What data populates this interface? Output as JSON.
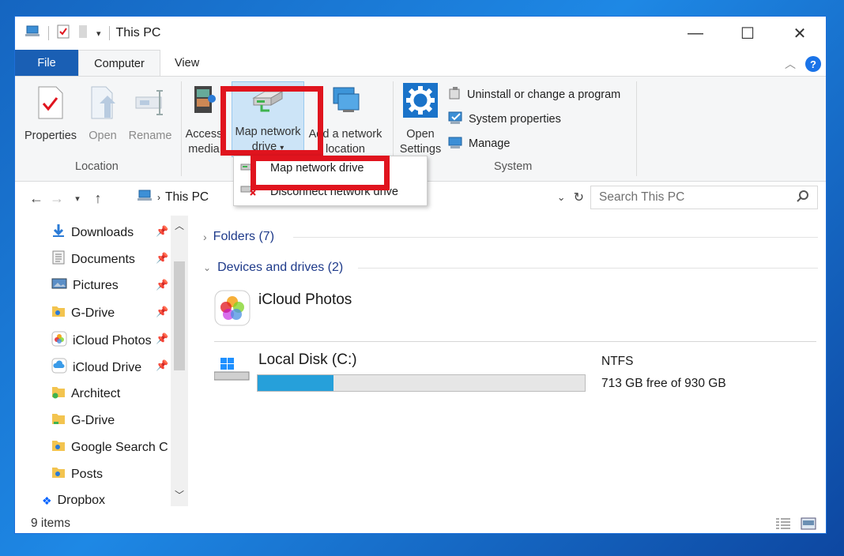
{
  "window": {
    "title": "This PC"
  },
  "tabs": [
    {
      "label": "File"
    },
    {
      "label": "Computer"
    },
    {
      "label": "View"
    }
  ],
  "ribbon": {
    "location_group": {
      "label": "Location",
      "properties": "Properties",
      "open": "Open",
      "rename": "Rename"
    },
    "network_group": {
      "access_media_1": "Access",
      "access_media_2": "media",
      "map_drive_1": "Map network",
      "map_drive_2": "drive",
      "add_location_1": "Add a network",
      "add_location_2": "location"
    },
    "system_group": {
      "label": "System",
      "open_settings_1": "Open",
      "open_settings_2": "Settings",
      "uninstall": "Uninstall or change a program",
      "system_properties": "System properties",
      "manage": "Manage"
    }
  },
  "dropdown": {
    "items": [
      {
        "label": "Map network drive"
      },
      {
        "label": "Disconnect network drive"
      }
    ]
  },
  "address": {
    "path": "This PC",
    "search_placeholder": "Search This PC"
  },
  "sidebar": {
    "items": [
      {
        "label": "Downloads",
        "icon": "download-arrow-icon",
        "pinned": true
      },
      {
        "label": "Documents",
        "icon": "document-icon",
        "pinned": true
      },
      {
        "label": "Pictures",
        "icon": "pictures-icon",
        "pinned": true
      },
      {
        "label": "G-Drive",
        "icon": "folder-user-icon",
        "pinned": true
      },
      {
        "label": "iCloud Photos",
        "icon": "icloud-photos-icon",
        "pinned": true
      },
      {
        "label": "iCloud Drive",
        "icon": "icloud-drive-icon",
        "pinned": true
      },
      {
        "label": "Architect",
        "icon": "folder-sync-icon",
        "pinned": false
      },
      {
        "label": "G-Drive",
        "icon": "folder-icon",
        "pinned": false
      },
      {
        "label": "Google Search C",
        "icon": "folder-user-icon",
        "pinned": false
      },
      {
        "label": "Posts",
        "icon": "folder-user-icon",
        "pinned": false
      },
      {
        "label": "Dropbox",
        "icon": "dropbox-icon",
        "pinned": false
      }
    ]
  },
  "content": {
    "folders_header": "Folders (7)",
    "devices_header": "Devices and drives (2)",
    "drives": [
      {
        "name": "iCloud Photos"
      },
      {
        "name": "Local Disk (C:)",
        "filesystem": "NTFS",
        "free_text": "713 GB free of 930 GB",
        "used_fraction": 0.233
      }
    ]
  },
  "status": {
    "items_count": "9 items"
  },
  "colors": {
    "accent": "#1a5fb4",
    "highlight_box": "#e0141e",
    "progress": "#26a0da"
  }
}
